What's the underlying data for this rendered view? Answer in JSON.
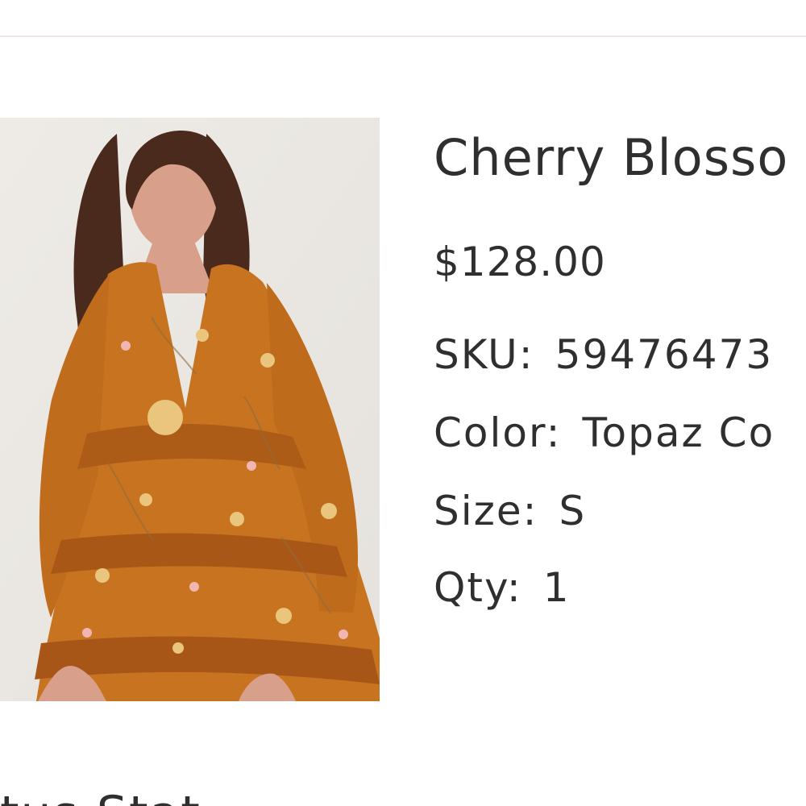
{
  "product": {
    "title": "Cherry Blosso",
    "price": "$128.00",
    "image": {
      "alt": "Model wearing an orange floral tiered mini dress",
      "dress_color": "#c7731f",
      "background_color": "#ece9e4",
      "hair_color": "#4a2a1c"
    },
    "details": {
      "sku_label": "SKU:",
      "sku_value": "59476473",
      "color_label": "Color:",
      "color_value": "Topaz Co",
      "size_label": "Size:",
      "size_value": "S",
      "qty_label": "Qty:",
      "qty_value": "1"
    }
  },
  "footer": {
    "partial_text": "tus Stat"
  },
  "colors": {
    "divider": "#f3e6ea",
    "text": "#2f2f2f"
  }
}
